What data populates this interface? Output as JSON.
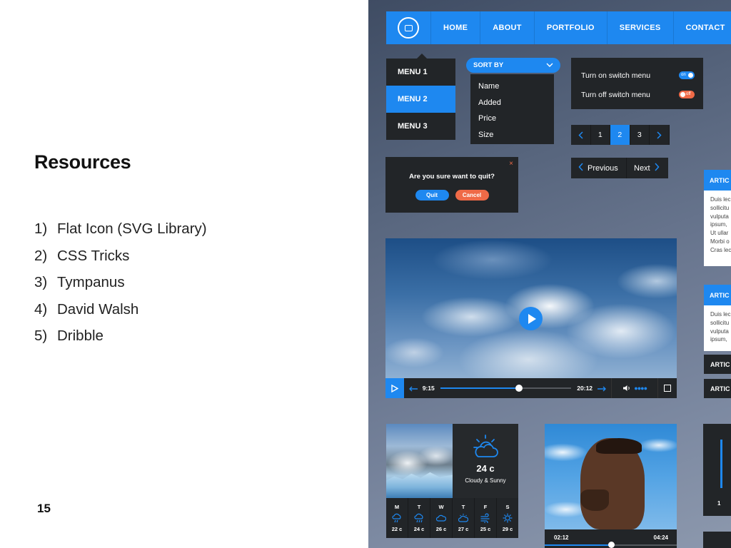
{
  "slide": {
    "title": "Resources",
    "resources": [
      {
        "num": "1)",
        "label": "Flat Icon (SVG Library)"
      },
      {
        "num": "2)",
        "label": "CSS Tricks"
      },
      {
        "num": "3)",
        "label": "Tympanus"
      },
      {
        "num": "4)",
        "label": "David Walsh"
      },
      {
        "num": "5)",
        "label": "Dribble"
      }
    ],
    "page_number": "15"
  },
  "colors": {
    "accent": "#1e88f0",
    "dark": "#222528",
    "danger": "#ef6a47"
  },
  "nav": {
    "logo_icon": "chat-ring-icon",
    "items": [
      "HOME",
      "ABOUT",
      "PORTFOLIO",
      "SERVICES",
      "CONTACT"
    ]
  },
  "menu": {
    "items": [
      "MENU 1",
      "MENU 2",
      "MENU 3"
    ],
    "active_index": 1
  },
  "sort": {
    "label": "SORT BY",
    "options": [
      "Name",
      "Added",
      "Price",
      "Size"
    ]
  },
  "switches": [
    {
      "label": "Turn on switch menu",
      "state": "on"
    },
    {
      "label": "Turn off switch menu",
      "state": "off"
    }
  ],
  "pagination": {
    "pages": [
      "1",
      "2",
      "3"
    ],
    "active": "2"
  },
  "prevnext": {
    "prev": "Previous",
    "next": "Next"
  },
  "dialog": {
    "question": "Are you sure want to quit?",
    "quit": "Quit",
    "cancel": "Cancel",
    "close": "×"
  },
  "articles": [
    {
      "header": "ARTIC",
      "lines": [
        "Duis lec",
        "sollicitu",
        "vulputa",
        "ipsum,",
        "Ut ullar",
        "Morbi o",
        "Cras lec"
      ]
    },
    {
      "header": "ARTIC",
      "lines": [
        "Duis lec",
        "sollicitu",
        "vulputa",
        "ipsum,"
      ]
    }
  ],
  "article_bars": [
    "ARTIC",
    "ARTIC"
  ],
  "video": {
    "current_time": "9:15",
    "total_time": "20:12",
    "progress": 0.6,
    "volume_icon": "volume-icon",
    "volume_dots": "●●●●"
  },
  "weather": {
    "temp": "24 c",
    "condition": "Cloudy & Sunny",
    "days": [
      {
        "day": "M",
        "icon": "cloud-rain-icon",
        "temp": "22 c"
      },
      {
        "day": "T",
        "icon": "cloud-rain-icon",
        "temp": "24 c"
      },
      {
        "day": "W",
        "icon": "cloud-icon",
        "temp": "26 c"
      },
      {
        "day": "T",
        "icon": "cloud-sun-icon",
        "temp": "27 c"
      },
      {
        "day": "F",
        "icon": "wind-icon",
        "temp": "25 c"
      },
      {
        "day": "S",
        "icon": "sun-icon",
        "temp": "29 c"
      }
    ]
  },
  "album": {
    "current_time": "02:12",
    "total_time": "04:24",
    "progress": 0.5
  },
  "side_widget": {
    "label": "1"
  }
}
